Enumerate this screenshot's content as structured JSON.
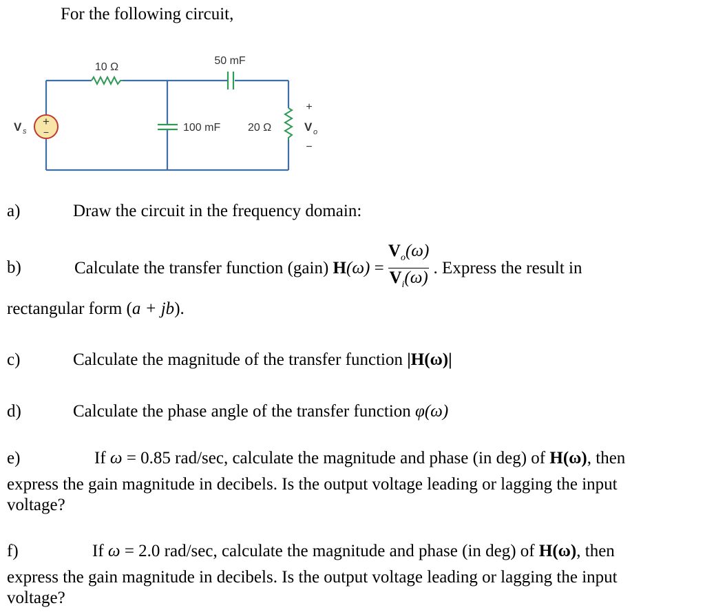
{
  "intro": "For the following circuit,",
  "circuit": {
    "source_label": "V",
    "source_sub": "s",
    "source_plus": "+",
    "source_minus": "−",
    "r1": "10 Ω",
    "c_series": "50 mF",
    "c_shunt": "100 mF",
    "r2": "20 Ω",
    "out_plus": "+",
    "out_label": "V",
    "out_sub": "o",
    "out_minus": "−",
    "colors": {
      "wire": "#3d6fa6",
      "component": "#2e9a55",
      "source_fill": "#f7e6a8",
      "source_stroke": "#c0392b"
    }
  },
  "questions": {
    "a": {
      "label": "a)",
      "text": "Draw the circuit in the frequency domain:"
    },
    "b": {
      "label": "b)",
      "text": "Calculate the transfer function (gain)",
      "H": "H",
      "omega_arg": "(ω)",
      "equals": " =",
      "num_V": "V",
      "num_sub": "o",
      "den_V": "V",
      "den_sub": "i",
      "after": ". Express the result in",
      "line2_pre": "rectangular form (",
      "line2_math": "a + jb",
      "line2_post": ")."
    },
    "c": {
      "label": "c)",
      "text": "Calculate the magnitude of the transfer function",
      "math": "|H(ω)|"
    },
    "d": {
      "label": "d)",
      "text": "Calculate the phase angle of the transfer function",
      "math": "φ(ω)"
    },
    "e": {
      "label": "e)",
      "pre": "If",
      "omega": "ω",
      "value": " = 0.85",
      "line1": " rad/sec, calculate the magnitude and phase (in deg) of ",
      "H": "H(ω)",
      "line1_end": ", then",
      "line2": "express the gain magnitude in decibels. Is the output voltage leading or lagging the input",
      "line3": "voltage?"
    },
    "f": {
      "label": "f)",
      "pre": "If",
      "omega": "ω",
      "value": " = 2.0",
      "line1": " rad/sec, calculate the magnitude and phase (in deg) of ",
      "H": "H(ω)",
      "line1_end": ", then",
      "line2": "express the gain magnitude in decibels. Is the output voltage leading or lagging the input",
      "line3": "voltage?"
    }
  }
}
